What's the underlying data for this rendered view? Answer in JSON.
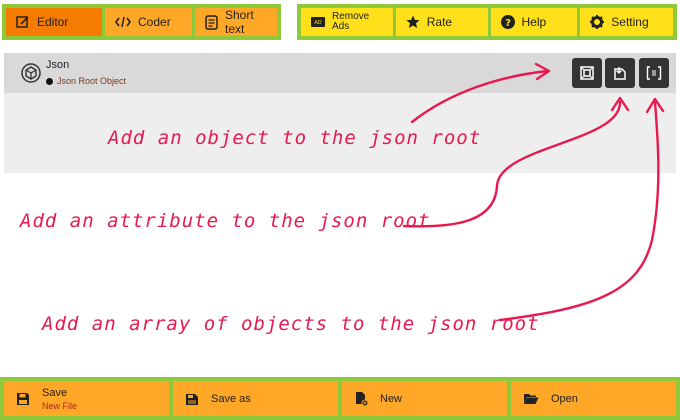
{
  "toolbar": {
    "editor": "Editor",
    "coder": "Coder",
    "short_text": "Short text",
    "remove_ads_line1": "Remove",
    "remove_ads_line2": "Ads",
    "rate": "Rate",
    "help": "Help",
    "setting": "Setting"
  },
  "tree": {
    "root_title": "Json",
    "root_subtitle": "Json Root Object"
  },
  "annotations": {
    "add_object": "Add an object to the json root",
    "add_attribute": "Add an attribute to the json root",
    "add_array": "Add an array of objects to the json root"
  },
  "bottom": {
    "save": "Save",
    "save_sub": "New File",
    "save_as": "Save as",
    "new": "New",
    "open": "Open"
  },
  "colors": {
    "toolbar_green": "#8fc93a",
    "orange": "#ffa726",
    "active_orange": "#f57c00",
    "yellow": "#ffe01b",
    "annotation_red": "#e8194f",
    "panel_gray": "#eeeeee",
    "root_row_gray": "#d9d9d9"
  }
}
